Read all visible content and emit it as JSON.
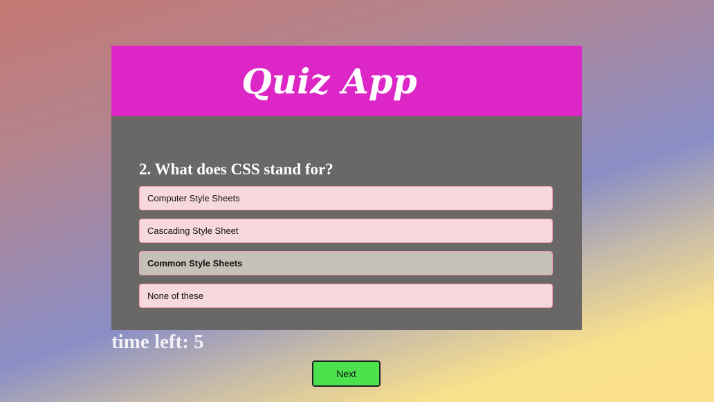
{
  "header": {
    "title": "Quiz App"
  },
  "question": {
    "text": "2. What does CSS stand for?",
    "options": [
      "Computer Style Sheets",
      "Cascading Style Sheet",
      "Common Style Sheets",
      "None of these"
    ],
    "selected_index": 2
  },
  "timer": {
    "text": "time left: 5"
  },
  "next_label": "Next"
}
